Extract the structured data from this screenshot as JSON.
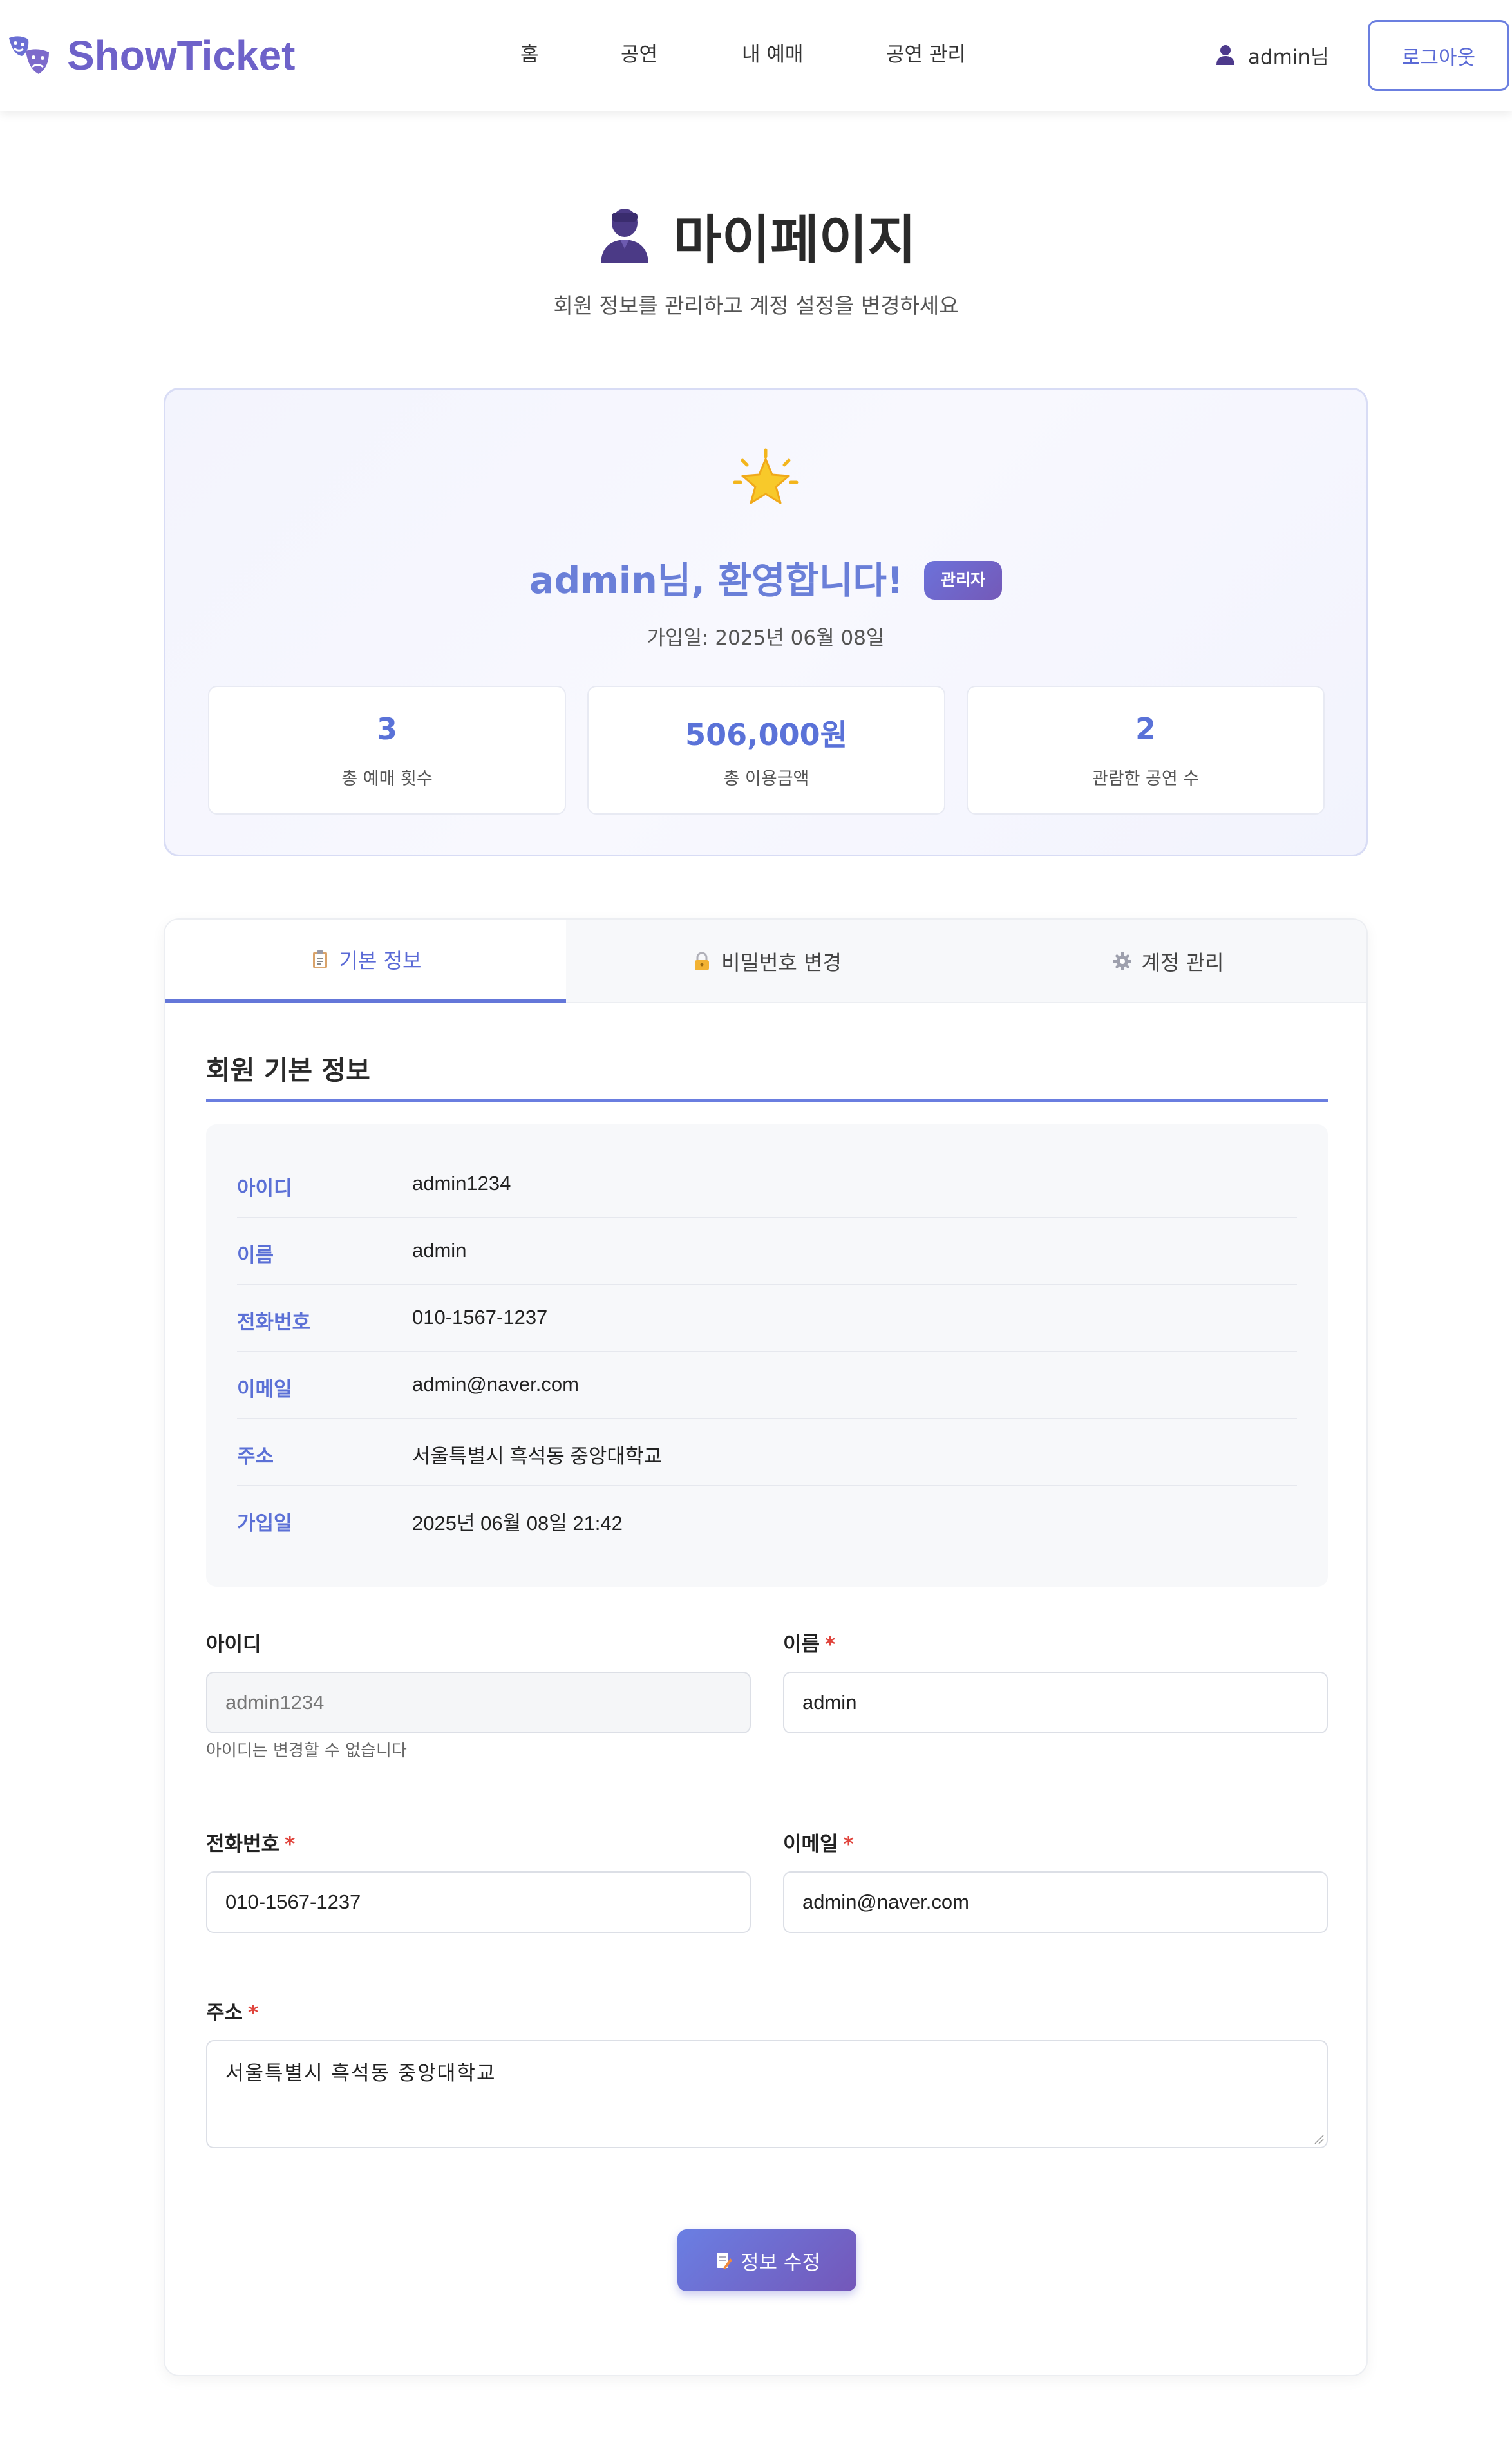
{
  "header": {
    "logo_text": "ShowTicket",
    "nav": [
      "홈",
      "공연",
      "내 예매",
      "공연 관리"
    ],
    "user_name": "admin님",
    "logout_label": "로그아웃"
  },
  "page": {
    "title": "마이페이지",
    "subtitle": "회원 정보를 관리하고 계정 설정을 변경하세요"
  },
  "welcome": {
    "greeting": "admin님, 환영합니다!",
    "badge": "관리자",
    "join_date": "가입일: 2025년 06월 08일",
    "stats": [
      {
        "value": "3",
        "label": "총 예매 횟수"
      },
      {
        "value": "506,000원",
        "label": "총 이용금액"
      },
      {
        "value": "2",
        "label": "관람한 공연 수"
      }
    ]
  },
  "tabs": [
    {
      "label": "기본 정보",
      "icon": "clipboard-icon",
      "active": true
    },
    {
      "label": "비밀번호 변경",
      "icon": "lock-icon",
      "active": false
    },
    {
      "label": "계정 관리",
      "icon": "gear-icon",
      "active": false
    }
  ],
  "info": {
    "section_title": "회원 기본 정보",
    "rows": [
      {
        "label": "아이디",
        "value": "admin1234"
      },
      {
        "label": "이름",
        "value": "admin"
      },
      {
        "label": "전화번호",
        "value": "010-1567-1237"
      },
      {
        "label": "이메일",
        "value": "admin@naver.com"
      },
      {
        "label": "주소",
        "value": "서울특별시 흑석동 중앙대학교"
      },
      {
        "label": "가입일",
        "value": "2025년 06월 08일 21:42"
      }
    ]
  },
  "form": {
    "id_label": "아이디",
    "id_value": "admin1234",
    "id_help": "아이디는 변경할 수 없습니다",
    "name_label": "이름",
    "name_value": "admin",
    "phone_label": "전화번호",
    "phone_value": "010-1567-1237",
    "email_label": "이메일",
    "email_value": "admin@naver.com",
    "address_label": "주소",
    "address_value": "서울특별시 흑석동 중앙대학교",
    "required_mark": "*",
    "submit_label": "정보 수정"
  },
  "colors": {
    "brand": "#6e62c9",
    "accent": "#5a72d8",
    "badge": "#7459b8",
    "required": "#e0443c"
  }
}
